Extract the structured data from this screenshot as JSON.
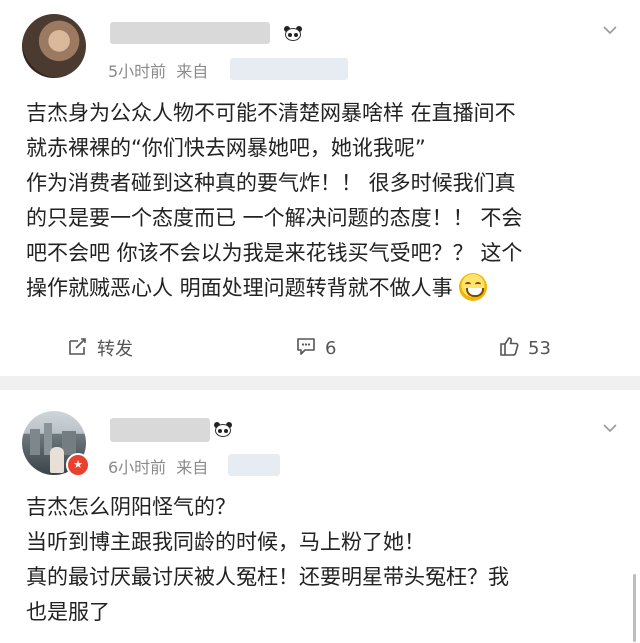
{
  "posts": [
    {
      "time": "5小时前",
      "from_label": "来自",
      "text_lines": [
        "吉杰身为公众人物不可能不清楚网暴啥样 在直播间不",
        "就赤裸裸的“你们快去网暴她吧，她讹我呢”",
        "作为消费者碰到这种真的要气炸！！ 很多时候我们真",
        "的只是要一个态度而已 一个解决问题的态度！！ 不会",
        "吧不会吧 你该不会以为我是来花钱买气受吧？？ 这个",
        "操作就贼恶心人 明面处理问题转背就不做人事"
      ],
      "actions": {
        "repost": "转发",
        "comments": "6",
        "likes": "53"
      },
      "icons": {
        "repost": "edit-share-icon",
        "comment": "comment-icon",
        "like": "thumbs-up-icon",
        "more": "chevron-down-icon",
        "emoji": "grin-sweat-emoji"
      }
    },
    {
      "time": "6小时前",
      "from_label": "来自",
      "text_lines": [
        "吉杰怎么阴阳怪气的？",
        "当听到博主跟我同龄的时候，马上粉了她！",
        "真的最讨厌最讨厌被人冤枉！还要明星带头冤枉？我",
        "也是服了"
      ],
      "icons": {
        "more": "chevron-down-icon",
        "badge": "verified-badge-icon"
      }
    }
  ],
  "colors": {
    "text": "#222222",
    "meta": "#8b8b8b",
    "divider": "#f0f0f0",
    "badge": "#e8412e"
  }
}
